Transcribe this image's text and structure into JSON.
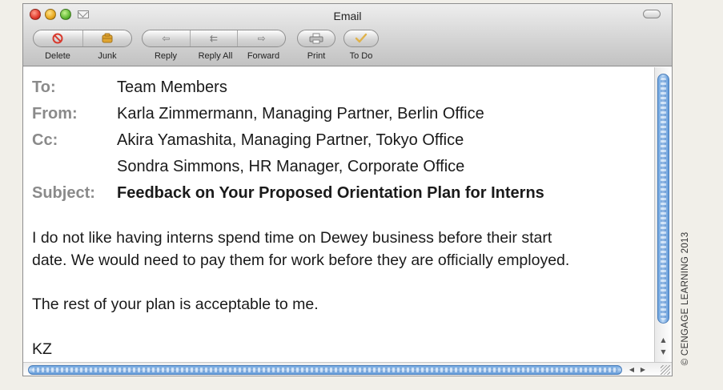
{
  "window": {
    "title": "Email"
  },
  "toolbar": {
    "buttons": [
      {
        "label": "Delete",
        "icon": "delete-icon"
      },
      {
        "label": "Junk",
        "icon": "junk-icon"
      },
      {
        "label": "Reply",
        "icon": "reply-icon"
      },
      {
        "label": "Reply All",
        "icon": "reply-all-icon"
      },
      {
        "label": "Forward",
        "icon": "forward-icon"
      },
      {
        "label": "Print",
        "icon": "print-icon"
      },
      {
        "label": "To Do",
        "icon": "todo-checkmark-icon"
      }
    ]
  },
  "message": {
    "to_label": "To:",
    "to_value": "Team Members",
    "from_label": "From:",
    "from_value": "Karla Zimmermann, Managing Partner, Berlin Office",
    "cc_label": "Cc:",
    "cc_values": [
      "Akira Yamashita, Managing Partner, Tokyo Office",
      "Sondra Simmons, HR Manager, Corporate Office"
    ],
    "subject_label": "Subject:",
    "subject_value": "Feedback on Your Proposed Orientation Plan for Interns",
    "body": [
      "I do not like having interns spend time on Dewey business before their start",
      "date. We would need to pay them for work before they are officially employed.",
      "The rest of your plan is acceptable to me.",
      "KZ"
    ]
  },
  "credit": "© CENGAGE LEARNING 2013",
  "colors": {
    "scroll_accent": "#6aa2de",
    "delete_red": "#d83a2e",
    "junk_gold": "#e0a531",
    "label_gray": "#8a8a8a"
  }
}
